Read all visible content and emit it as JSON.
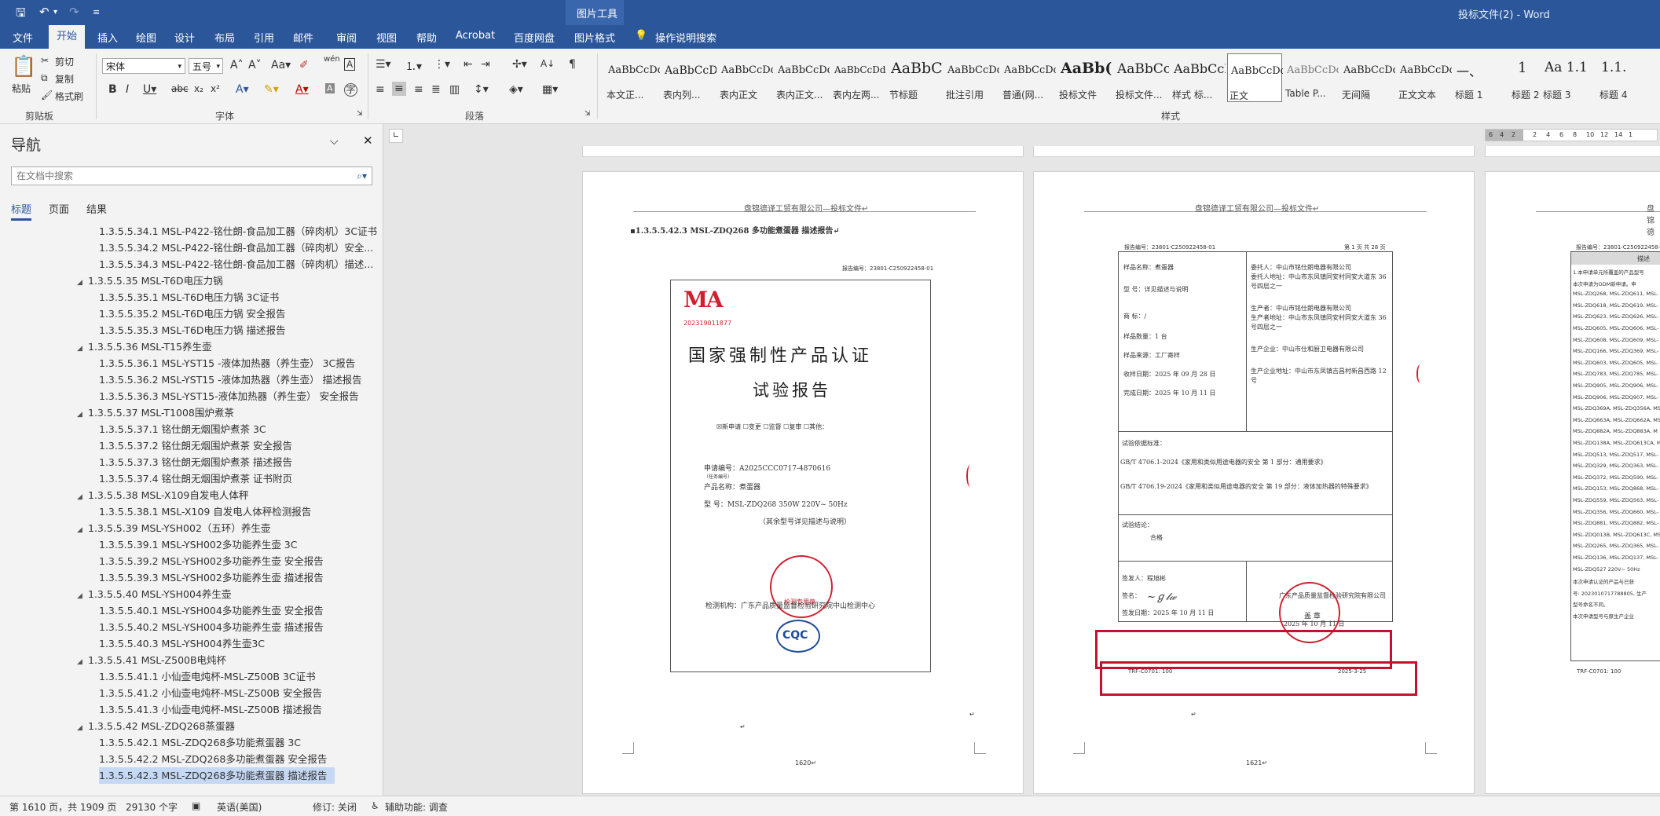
{
  "titlebar": {
    "context_group": "图片工具",
    "doc_title": "投标文件(2) - Word"
  },
  "tabs": [
    {
      "label": "文件"
    },
    {
      "label": "开始"
    },
    {
      "label": "插入"
    },
    {
      "label": "绘图"
    },
    {
      "label": "设计"
    },
    {
      "label": "布局"
    },
    {
      "label": "引用"
    },
    {
      "label": "邮件"
    },
    {
      "label": "审阅"
    },
    {
      "label": "视图"
    },
    {
      "label": "帮助"
    },
    {
      "label": "Acrobat"
    },
    {
      "label": "百度网盘"
    },
    {
      "label": "图片格式"
    }
  ],
  "tell_me": "操作说明搜索",
  "clipboard": {
    "paste": "粘贴",
    "cut": "剪切",
    "copy": "复制",
    "format_painter": "格式刷",
    "group": "剪贴板"
  },
  "font": {
    "name": "宋体",
    "size": "五号",
    "group": "字体"
  },
  "paragraph": {
    "group": "段落"
  },
  "styles": {
    "group": "样式",
    "items": [
      {
        "preview": "AaBbCcDdI",
        "name": "本文正..."
      },
      {
        "preview": "AaBbCcD",
        "name": "表内列..."
      },
      {
        "preview": "AaBbCcDdI",
        "name": "表内正文"
      },
      {
        "preview": "AaBbCcDdI",
        "name": "表内正文..."
      },
      {
        "preview": "AaBbCcDdEe",
        "name": "表内左两..."
      },
      {
        "preview": "AaBbC",
        "name": "节标题"
      },
      {
        "preview": "AaBbCcDd",
        "name": "批注引用"
      },
      {
        "preview": "AaBbCcDc",
        "name": "普通(网..."
      },
      {
        "preview": "AaBb(",
        "name": "投标文件"
      },
      {
        "preview": "AaBbCc",
        "name": "投标文件..."
      },
      {
        "preview": "AaBbCcI",
        "name": "样式 标..."
      },
      {
        "preview": "AaBbCcDdI",
        "name": "正文"
      },
      {
        "preview": "AaBbCcDc",
        "name": "Table P..."
      },
      {
        "preview": "AaBbCcDdI",
        "name": "无间隔"
      },
      {
        "preview": "AaBbCcDd",
        "name": "正文文本"
      },
      {
        "preview": "一、",
        "name": "标题 1"
      },
      {
        "preview": "1",
        "name": "标题 2"
      },
      {
        "preview": "Aa 1.1",
        "name": "标题 3"
      },
      {
        "preview": "1.1.",
        "name": "标题 4"
      }
    ]
  },
  "nav": {
    "title": "导航",
    "search_placeholder": "在文档中搜索",
    "tabs": [
      {
        "label": "标题"
      },
      {
        "label": "页面"
      },
      {
        "label": "结果"
      }
    ],
    "items": [
      {
        "text": "1.3.5.5.34.1 MSL-P422-铭仕朗-食品加工器（碎肉机）3C证书",
        "level": 2
      },
      {
        "text": "1.3.5.5.34.2 MSL-P422-铭仕朗-食品加工器（碎肉机）安全...",
        "level": 2
      },
      {
        "text": "1.3.5.5.34.3 MSL-P422-铭仕朗-食品加工器（碎肉机）描述...",
        "level": 2
      },
      {
        "text": "1.3.5.5.35 MSL-T6D电压力锅",
        "level": 1
      },
      {
        "text": "1.3.5.5.35.1 MSL-T6D电压力锅 3C证书",
        "level": 2
      },
      {
        "text": "1.3.5.5.35.2 MSL-T6D电压力锅 安全报告",
        "level": 2
      },
      {
        "text": "1.3.5.5.35.3 MSL-T6D电压力锅 描述报告",
        "level": 2
      },
      {
        "text": "1.3.5.5.36 MSL-T15养生壶",
        "level": 1
      },
      {
        "text": "1.3.5.5.36.1 MSL-YST15 -液体加热器（养生壶） 3C报告",
        "level": 2
      },
      {
        "text": "1.3.5.5.36.2 MSL-YST15 -液体加热器（养生壶） 描述报告",
        "level": 2
      },
      {
        "text": "1.3.5.5.36.3 MSL-YST15-液体加热器（养生壶）  安全报告",
        "level": 2
      },
      {
        "text": "1.3.5.5.37 MSL-T1008围炉煮茶",
        "level": 1
      },
      {
        "text": "1.3.5.5.37.1 铭仕朗无烟围炉煮茶  3C",
        "level": 2
      },
      {
        "text": "1.3.5.5.37.2 铭仕朗无烟围炉煮茶  安全报告",
        "level": 2
      },
      {
        "text": "1.3.5.5.37.3 铭仕朗无烟围炉煮茶  描述报告",
        "level": 2
      },
      {
        "text": "1.3.5.5.37.4 铭仕朗无烟围炉煮茶  证书附页",
        "level": 2
      },
      {
        "text": "1.3.5.5.38 MSL-X109自发电人体秤",
        "level": 1
      },
      {
        "text": "1.3.5.5.38.1 MSL-X109 自发电人体秤检测报告",
        "level": 2
      },
      {
        "text": "1.3.5.5.39 MSL-YSH002（五环）养生壶",
        "level": 1
      },
      {
        "text": "1.3.5.5.39.1 MSL-YSH002多功能养生壶 3C",
        "level": 2
      },
      {
        "text": "1.3.5.5.39.2 MSL-YSH002多功能养生壶 安全报告",
        "level": 2
      },
      {
        "text": "1.3.5.5.39.3 MSL-YSH002多功能养生壶 描述报告",
        "level": 2
      },
      {
        "text": "1.3.5.5.40 MSL-YSH004养生壶",
        "level": 1
      },
      {
        "text": "1.3.5.5.40.1 MSL-YSH004多功能养生壶 安全报告",
        "level": 2
      },
      {
        "text": "1.3.5.5.40.2 MSL-YSH004多功能养生壶 描述报告",
        "level": 2
      },
      {
        "text": "1.3.5.5.40.3 MSL-YSH004养生壶3C",
        "level": 2
      },
      {
        "text": "1.3.5.5.41 MSL-Z500B电炖杯",
        "level": 1
      },
      {
        "text": "1.3.5.5.41.1 小仙壶电炖杯-MSL-Z500B  3C证书",
        "level": 2
      },
      {
        "text": "1.3.5.5.41.2 小仙壶电炖杯-MSL-Z500B  安全报告",
        "level": 2
      },
      {
        "text": "1.3.5.5.41.3 小仙壶电炖杯-MSL-Z500B  描述报告",
        "level": 2
      },
      {
        "text": "1.3.5.5.42 MSL-ZDQ268蒸蛋器",
        "level": 1
      },
      {
        "text": "1.3.5.5.42.1 MSL-ZDQ268多功能煮蛋器 3C",
        "level": 2
      },
      {
        "text": "1.3.5.5.42.2 MSL-ZDQ268多功能煮蛋器 安全报告",
        "level": 2
      },
      {
        "text": "1.3.5.5.42.3 MSL-ZDQ268多功能煮蛋器 描述报告",
        "level": 2,
        "selected": true
      }
    ]
  },
  "ruler": {
    "ticks": [
      "6",
      "4",
      "2",
      "2",
      "4",
      "6",
      "8",
      "10",
      "12",
      "14",
      "1"
    ]
  },
  "page1": {
    "header": "盘锦德译工贸有限公司—投标文件↵",
    "heading": "▪1.3.5.5.42.3  MSL-ZDQ268 多功能煮蛋器 描述报告↵",
    "report_no": "报告编号：23801-C250922458-01",
    "cma": "MA",
    "cma_no": "202319011877",
    "title1": "国家强制性产品认证",
    "title2": "试验报告",
    "checkboxes": "☒新申请  ☐变更  ☐监督  ☐复审  ☐其他：",
    "app_no": "申请编号：A2025CCC0717-4870616",
    "app_note": "（任务编号）",
    "product": "产品名称：煮蛋器",
    "model": "型    号：MSL-ZDQ268 350W 220V~ 50Hz",
    "model_note": "（其余型号详见描述与说明）",
    "lab": "检测机构：广东产品质量监督检验研究院中山检测中心",
    "cqc": "CQC",
    "stamp_text": "检测专用章",
    "page_no": "1620↵"
  },
  "page2": {
    "header": "盘锦德译工贸有限公司—投标文件↵",
    "report_no": "报告编号：23801-C250922458-01",
    "page_of": "第 1 页 共 28 页",
    "left_rows": [
      "样品名称：煮蛋器",
      "型    号：详见描述与说明",
      "商    标：/",
      "样品数量：1 台",
      "样品来源：工厂寄样",
      "收样日期：2025 年 09 月 28 日",
      "完成日期：2025 年 10 月 11 日"
    ],
    "right_rows": [
      "委托人：中山市铭仕朗电器有限公司",
      "委托人地址：中山市东凤镇同安村同安大道东 36 号四层之一",
      "生产者：中山市铭仕朗电器有限公司",
      "生产者地址：中山市东凤镇同安村同安大道东 36 号四层之一",
      "生产企业：中山市仕和厨卫电器有限公司",
      "生产企业地址：中山市东凤镇吉昌村新昌西路 12 号"
    ],
    "basis_title": "试验依据标准：",
    "basis1": "GB/T 4706.1-2024《家用和类似用途电器的安全 第 1 部分：通用要求》",
    "basis2": "GB/T 4706.19-2024《家用和类似用途电器的安全 第 19 部分：液体加热器的特殊要求》",
    "conclusion_title": "试验结论：",
    "conclusion": "合格",
    "issuer": "签发人：程旭彬",
    "sign": "签名：",
    "issue_date": "签发日期：2025 年 10 月 11 日",
    "org": "广东产品质量监督检验研究院有限公司",
    "seal": "盖 章",
    "seal_date": "2025 年 10 月 11 日",
    "trf": "TRF-C0701: 100",
    "trf_date": "2025-3-25",
    "page_no": "1621↵"
  },
  "page3": {
    "header": "盘锦德",
    "report_no": "报告编号：23801-C250922458-01",
    "col_title": "描述",
    "lines": [
      "1.本申请单元所覆盖的产品型号",
      "   本次申请为ODM新申请。申",
      "MSL-ZDQ268, MSL-ZDQ611, MSL-",
      "MSL-ZDQ618, MSL-ZDQ619, MSL-",
      "MSL-ZDQ623, MSL-ZDQ626, MSL-",
      "MSL-ZDQ605, MSL-ZDQ606, MSL-",
      "MSL-ZDQ608, MSL-ZDQ609, MSL-",
      "MSL-ZDQ166, MSL-ZDQ369, MSL-",
      "MSL-ZDQ603, MSL-ZDQ605, MSL-",
      "MSL-ZDQ783, MSL-ZDQ785, MSL-",
      "MSL-ZDQ905, MSL-ZDQ906, MSL-",
      "MSL-ZDQ906, MSL-ZDQ907, MSL-",
      "MSL-ZDQ369A, MSL-ZDQ356A, MSL",
      "MSL-ZDQ663A, MSL-ZDQ662A, MSL",
      "MSL-ZDQ882A, MSL-ZDQ883A, M",
      "MSL-ZDQ138A, MSL-ZDQ613CA, MS",
      "MSL-ZDQ513, MSL-ZDQ517, MSL-",
      "MSL-ZDQ329, MSL-ZDQ363, MSL-",
      "MSL-ZDQ372, MSL-ZDQ590, MSL-",
      "MSL-ZDQ153, MSL-ZDQ868, MSL-",
      "MSL-ZDQ559, MSL-ZDQ563, MSL-",
      "MSL-ZDQ356, MSL-ZDQ660, MSL-",
      "MSL-ZDQ881, MSL-ZDQ882, MSL-",
      "MSL-ZDQ013B, MSL-ZDQ613C, MSL",
      "MSL-ZDQ265, MSL-ZDQ365, MSL-",
      "MSL-ZDQ136, MSL-ZDQ137, MSL-",
      "MSL-ZDQ527 220V~ 50Hz",
      "   本次申请认证的产品与已获",
      "号: 2023010717788805, 生产",
      "型号命名不同。",
      "   本次申请型号与原生产企业"
    ],
    "trf": "TRF-C0701: 100"
  },
  "status": {
    "page": "第 1610 页，共 1909 页",
    "words": "29130 个字",
    "lang": "英语(美国)",
    "track": "修订: 关闭",
    "access": "辅助功能: 调查"
  },
  "colors": {
    "brand": "#2b579a",
    "highlight": "#c8102e"
  }
}
